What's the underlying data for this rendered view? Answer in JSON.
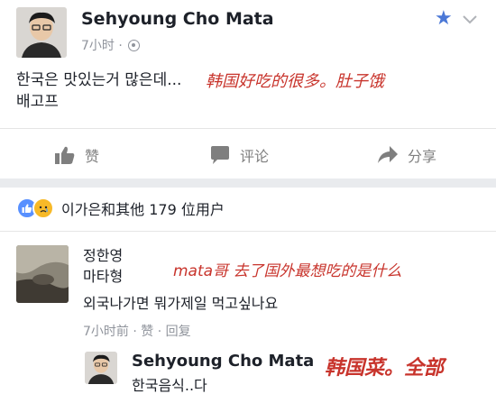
{
  "post": {
    "author": "Sehyoung Cho Mata",
    "time": "7小时 ·",
    "text_line1": "한국은 맛있는거 많은데...",
    "text_line2": "배고프",
    "overlay_translation": "韩国好吃的很多。肚子饿"
  },
  "header_icons": {
    "star": "star-icon",
    "chevron": "chevron-down-icon",
    "star_color": "#4b78d6"
  },
  "actions": {
    "like": "赞",
    "comment": "评论",
    "share": "分享"
  },
  "reactions": {
    "summary": "이가은和其他 179 位用户",
    "like_color": "#5890ff",
    "sad_color": "#f7b928"
  },
  "comment": {
    "author": "정한영",
    "line1": "마타형",
    "line2": "외국나가면 뭐가제일 먹고싶나요",
    "meta": "7小时前 · 赞 · 回复",
    "overlay_translation": "mata哥 去了国外最想吃的是什么"
  },
  "reply": {
    "author": "Sehyoung Cho Mata",
    "text": "한국음식..다",
    "overlay_translation": "韩国菜。全部"
  },
  "colors": {
    "overlay_red": "#c8342c",
    "meta_gray": "#90949c"
  }
}
